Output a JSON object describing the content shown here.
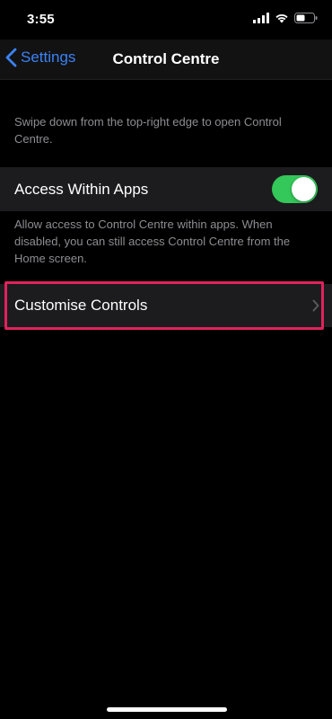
{
  "status_bar": {
    "time": "3:55",
    "icons": [
      "cellular-signal-icon",
      "wifi-icon",
      "battery-icon"
    ]
  },
  "nav": {
    "back_label": "Settings",
    "title": "Control Centre"
  },
  "intro_text": "Swipe down from the top-right edge to open Control Centre.",
  "access_within_apps": {
    "label": "Access Within Apps",
    "toggle_on": true,
    "footer": "Allow access to Control Centre within apps. When disabled, you can still access Control Centre from the Home screen."
  },
  "customise_controls": {
    "label": "Customise Controls"
  },
  "colors": {
    "accent_blue": "#3b82f6",
    "toggle_green": "#34c759",
    "highlight_pink": "#e0225d",
    "cell_background": "#1c1c1e",
    "secondary_text": "#8d8d92"
  }
}
